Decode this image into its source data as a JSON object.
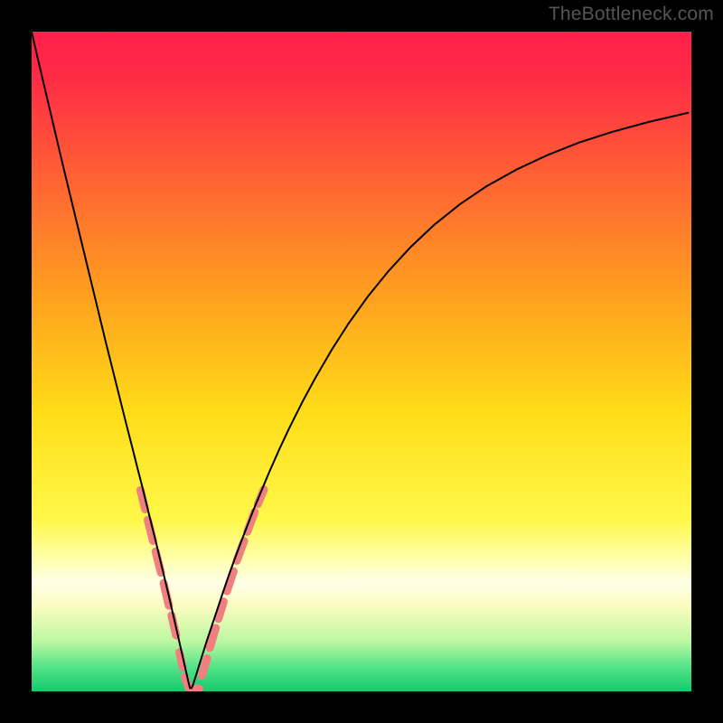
{
  "watermark": "TheBottleneck.com",
  "chart_data": {
    "type": "line",
    "title": "",
    "xlabel": "",
    "ylabel": "",
    "xlim": [
      0,
      100
    ],
    "ylim": [
      0,
      100
    ],
    "background_gradient": {
      "stops": [
        {
          "offset": 0,
          "color": "#ff1f4b"
        },
        {
          "offset": 0.07,
          "color": "#ff2b46"
        },
        {
          "offset": 0.2,
          "color": "#ff5a36"
        },
        {
          "offset": 0.4,
          "color": "#ffa01f"
        },
        {
          "offset": 0.58,
          "color": "#ffdd18"
        },
        {
          "offset": 0.74,
          "color": "#fff84a"
        },
        {
          "offset": 0.8,
          "color": "#ffffad"
        },
        {
          "offset": 0.835,
          "color": "#ffffe8"
        },
        {
          "offset": 0.87,
          "color": "#fcfcc0"
        },
        {
          "offset": 0.925,
          "color": "#bbf7a0"
        },
        {
          "offset": 0.965,
          "color": "#4fe286"
        },
        {
          "offset": 1.0,
          "color": "#18c86f"
        }
      ]
    },
    "series": [
      {
        "name": "bottleneck-curve",
        "color": "#000000",
        "width": 2.0,
        "x": [
          0.0,
          0.8,
          1.6,
          2.4,
          3.2,
          4.0,
          4.8,
          5.6,
          6.4,
          7.2,
          8.0,
          8.8,
          9.6,
          10.4,
          11.2,
          12.0,
          12.8,
          13.6,
          14.4,
          15.2,
          16.0,
          16.8,
          17.6,
          18.2,
          18.8,
          19.4,
          20.0,
          20.5,
          21.0,
          21.5,
          22.0,
          22.25,
          22.5,
          22.75,
          23.0,
          23.25,
          23.5,
          23.75,
          24.0,
          24.25,
          24.5,
          24.75,
          25.0,
          25.5,
          26.0,
          26.5,
          27.0,
          27.5,
          28.0,
          28.5,
          29.0,
          29.75,
          30.5,
          31.5,
          32.5,
          33.5,
          34.5,
          36.0,
          37.5,
          39.0,
          41.0,
          43.0,
          45.5,
          48.0,
          51.0,
          54.0,
          57.5,
          61.0,
          65.0,
          69.0,
          73.5,
          78.0,
          83.0,
          88.0,
          93.5,
          99.5
        ],
        "y": [
          100.0,
          96.5,
          93.1,
          89.7,
          86.3,
          82.9,
          79.5,
          76.2,
          72.9,
          69.6,
          66.3,
          63.0,
          59.7,
          56.4,
          53.1,
          49.9,
          46.7,
          43.5,
          40.3,
          37.2,
          34.0,
          30.9,
          27.6,
          25.2,
          22.8,
          20.3,
          17.8,
          15.7,
          13.6,
          11.4,
          9.2,
          8.1,
          7.0,
          5.9,
          4.8,
          3.7,
          2.6,
          1.5,
          0.5,
          0.5,
          1.1,
          1.9,
          2.7,
          4.3,
          5.9,
          7.5,
          9.0,
          10.5,
          12.0,
          13.5,
          15.0,
          17.2,
          19.3,
          22.0,
          24.6,
          27.2,
          29.6,
          33.2,
          36.6,
          39.8,
          43.8,
          47.5,
          51.8,
          55.7,
          59.9,
          63.6,
          67.4,
          70.7,
          73.9,
          76.6,
          79.1,
          81.2,
          83.2,
          84.8,
          86.3,
          87.7
        ]
      }
    ],
    "markers": {
      "name": "highlight-dashes",
      "color": "#f08080",
      "stroke_width": 9,
      "cap": "round",
      "segments": [
        {
          "x1": 16.5,
          "y1": 30.5,
          "x2": 17.2,
          "y2": 27.6
        },
        {
          "x1": 17.6,
          "y1": 26.0,
          "x2": 18.4,
          "y2": 22.8
        },
        {
          "x1": 18.8,
          "y1": 21.2,
          "x2": 19.6,
          "y2": 18.0
        },
        {
          "x1": 20.0,
          "y1": 16.4,
          "x2": 20.8,
          "y2": 13.0
        },
        {
          "x1": 21.2,
          "y1": 11.5,
          "x2": 21.9,
          "y2": 8.5
        },
        {
          "x1": 22.4,
          "y1": 5.9,
          "x2": 22.9,
          "y2": 3.6
        },
        {
          "x1": 23.2,
          "y1": 2.2,
          "x2": 23.8,
          "y2": 0.5
        },
        {
          "x1": 24.2,
          "y1": 0.4,
          "x2": 25.4,
          "y2": 0.4
        },
        {
          "x1": 25.8,
          "y1": 2.4,
          "x2": 26.6,
          "y2": 5.0
        },
        {
          "x1": 27.0,
          "y1": 6.6,
          "x2": 27.9,
          "y2": 9.6
        },
        {
          "x1": 28.3,
          "y1": 11.0,
          "x2": 29.1,
          "y2": 13.6
        },
        {
          "x1": 29.6,
          "y1": 15.2,
          "x2": 30.6,
          "y2": 18.2
        },
        {
          "x1": 31.1,
          "y1": 19.8,
          "x2": 32.2,
          "y2": 22.8
        },
        {
          "x1": 32.7,
          "y1": 24.2,
          "x2": 33.8,
          "y2": 27.2
        },
        {
          "x1": 34.3,
          "y1": 28.4,
          "x2": 35.2,
          "y2": 30.6
        }
      ]
    }
  }
}
